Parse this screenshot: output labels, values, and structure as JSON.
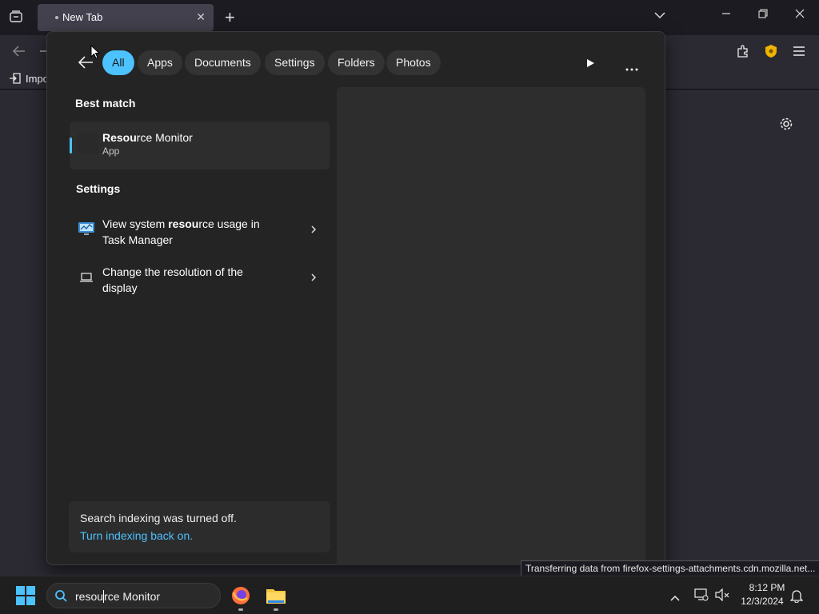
{
  "browser": {
    "tab_title": "New Tab",
    "tab_close": "✕",
    "new_tab": "+",
    "bookmark_import": "Impo",
    "status_text": "Transferring data from firefox-settings-attachments.cdn.mozilla.net..."
  },
  "search_panel": {
    "filters": [
      "All",
      "Apps",
      "Documents",
      "Settings",
      "Folders",
      "Photos"
    ],
    "best_match_heading": "Best match",
    "best_match": {
      "title_bold": "Resou",
      "title_rest": "rce Monitor",
      "subtitle": "App"
    },
    "settings_heading": "Settings",
    "settings_items": [
      {
        "pre": "View system ",
        "bold": "resou",
        "post": "rce usage in",
        "line2": "Task Manager"
      },
      {
        "pre": "Change the resolution of the",
        "bold": "",
        "post": "",
        "line2": "display"
      }
    ],
    "notice_text": "Search indexing was turned off.",
    "notice_link": "Turn indexing back on."
  },
  "taskbar": {
    "search_query_prefix": "resou",
    "search_query_suffix": "rce Monitor",
    "time": "8:12 PM",
    "date": "12/3/2024"
  },
  "colors": {
    "accent": "#4cc2ff",
    "panel_bg": "#242424",
    "taskbar_bg": "#1f1f1f"
  }
}
